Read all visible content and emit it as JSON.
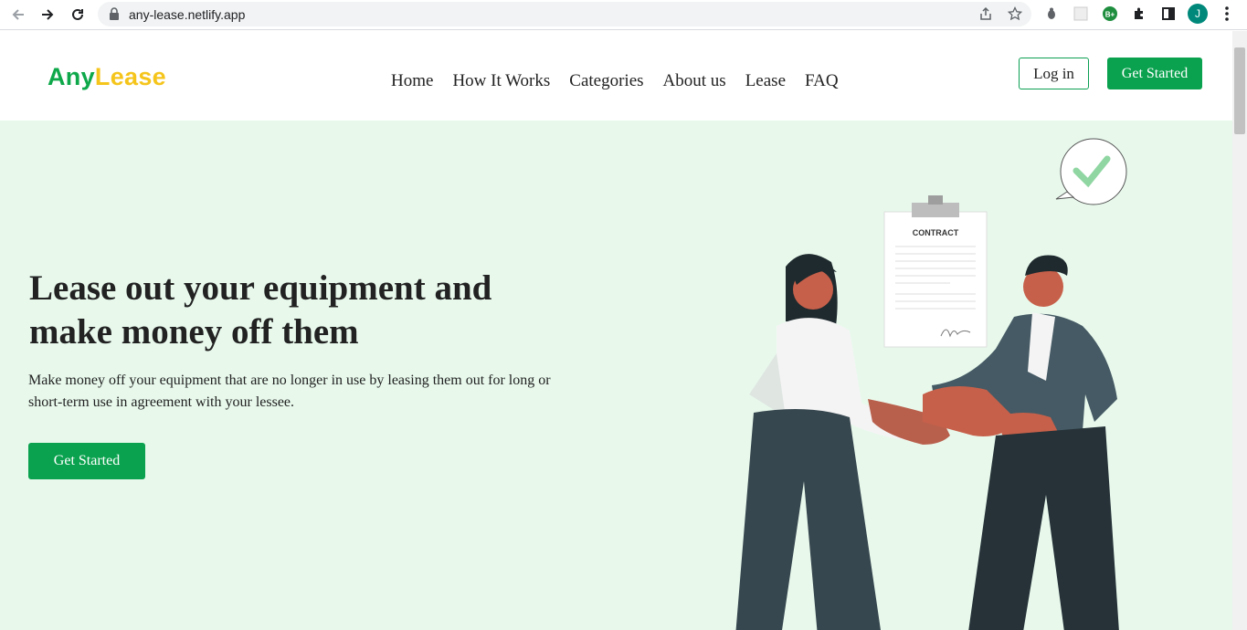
{
  "browser": {
    "url": "any-lease.netlify.app",
    "profile_initial": "J",
    "extension_badge": "B+"
  },
  "header": {
    "logo_part1": "Any",
    "logo_part2": "Lease",
    "nav": [
      "Home",
      "How It Works",
      "Categories",
      "About us",
      "Lease",
      "FAQ"
    ],
    "login_label": "Log in",
    "get_started_label": "Get Started"
  },
  "hero": {
    "heading": "Lease out your equipment and make money off them",
    "description": "Make money off your equipment that are no longer in use by leasing them out for long or short-term use in agreement with your lessee.",
    "cta_label": "Get Started",
    "contract_label": "CONTRACT"
  },
  "colors": {
    "brand_green": "#0aa24e",
    "brand_yellow": "#f5c51c",
    "hero_background": "#e8f9ec"
  }
}
